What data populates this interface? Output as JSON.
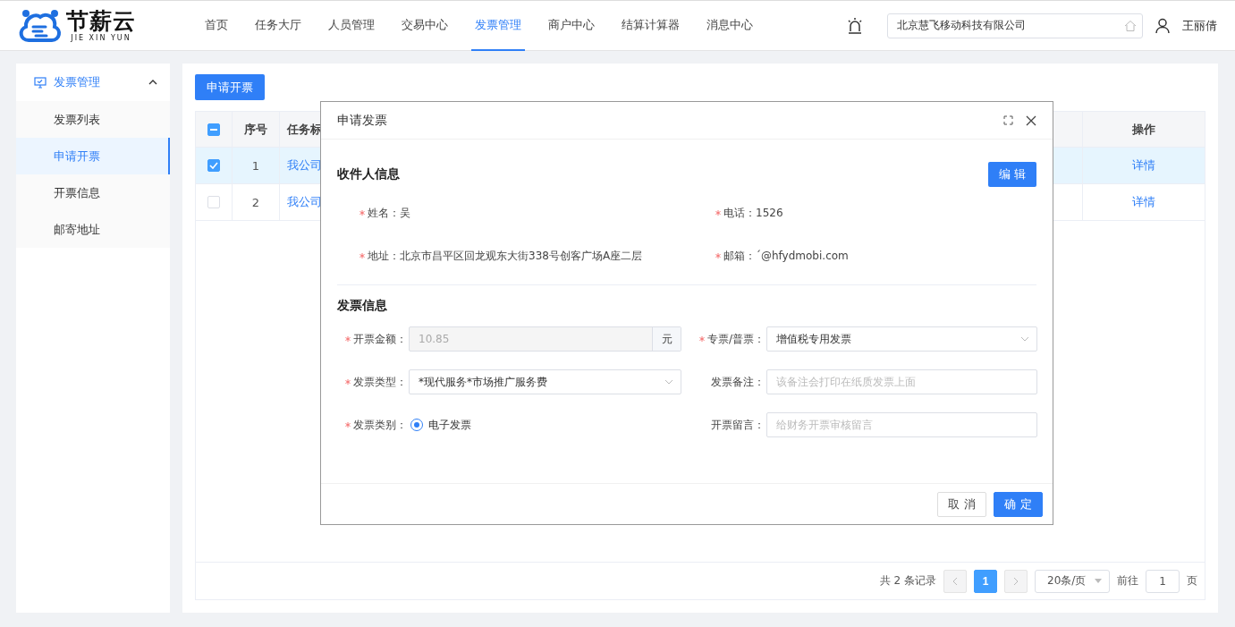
{
  "brand": {
    "name": "节薪云",
    "subtitle": "JIE XIN YUN"
  },
  "nav": [
    {
      "label": "首页",
      "selected": false
    },
    {
      "label": "任务大厅",
      "selected": false
    },
    {
      "label": "人员管理",
      "selected": false
    },
    {
      "label": "交易中心",
      "selected": false
    },
    {
      "label": "发票管理",
      "selected": true
    },
    {
      "label": "商户中心",
      "selected": false
    },
    {
      "label": "结算计算器",
      "selected": false
    },
    {
      "label": "消息中心",
      "selected": false
    }
  ],
  "company_field": {
    "value": "北京慧飞移动科技有限公司"
  },
  "user": {
    "name": "王丽倩"
  },
  "sidebar": {
    "group": {
      "label": "发票管理",
      "expanded": true
    },
    "items": [
      {
        "label": "发票列表",
        "selected": false
      },
      {
        "label": "申请开票",
        "selected": true
      },
      {
        "label": "开票信息",
        "selected": false
      },
      {
        "label": "邮寄地址",
        "selected": false
      }
    ]
  },
  "apply_button": "申请开票",
  "table": {
    "header_checkbox": {
      "indeterminate": true
    },
    "columns": [
      "序号",
      "任务标",
      "操作"
    ],
    "rows": [
      {
        "index": "1",
        "title": "我公司",
        "action": "详情",
        "checked": true,
        "selected": true
      },
      {
        "index": "2",
        "title": "我公司",
        "action": "详情",
        "checked": false,
        "selected": false
      }
    ]
  },
  "pagination": {
    "total": "共 2 条记录",
    "pages": [
      {
        "label": "1",
        "selected": true
      }
    ],
    "page_size": "20条/页",
    "goto_label": "前往",
    "goto_value": "1",
    "goto_suffix": "页"
  },
  "dialog": {
    "title": "申请发票",
    "recipient": {
      "heading": "收件人信息",
      "edit_button": "编 辑",
      "fields": [
        {
          "label": "姓名：",
          "value": "吴",
          "required": true
        },
        {
          "label": "电话：",
          "value": "1526",
          "required": true
        },
        {
          "label": "地址：",
          "value": "北京市昌平区回龙观东大街338号创客广场A座二层",
          "required": true
        },
        {
          "label": "邮箱：",
          "value": "´@hfydmobi.com",
          "required": true
        }
      ]
    },
    "invoice": {
      "heading": "发票信息",
      "fields": [
        {
          "kind": "suffix",
          "label": "开票金额：",
          "value": "10.85",
          "suffix": "元",
          "required": true,
          "disabled": true
        },
        {
          "kind": "select",
          "label": "专票/普票：",
          "value": "增值税专用发票",
          "required": true
        },
        {
          "kind": "select",
          "label": "发票类型：",
          "value": "*现代服务*市场推广服务费",
          "required": true
        },
        {
          "kind": "text",
          "label": "发票备注：",
          "placeholder": "该备注会打印在纸质发票上面",
          "required": false
        },
        {
          "kind": "radio",
          "label": "发票类别：",
          "options": [
            {
              "label": "电子发票",
              "selected": true
            }
          ],
          "required": true
        },
        {
          "kind": "text",
          "label": "开票留言：",
          "placeholder": "给财务开票审核留言",
          "required": false
        }
      ]
    },
    "buttons": [
      {
        "label": "取 消",
        "kind": "secondary"
      },
      {
        "label": "确 定",
        "kind": "primary"
      }
    ]
  }
}
